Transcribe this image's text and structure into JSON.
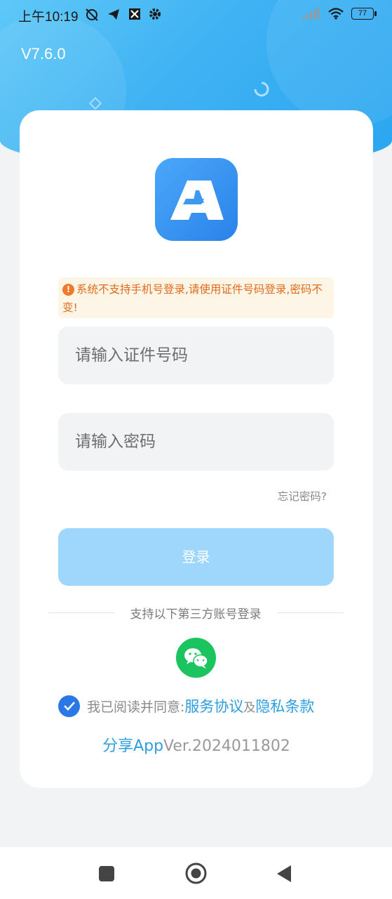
{
  "status_bar": {
    "time": "上午10:19",
    "battery": "77"
  },
  "header": {
    "version": "V7.6.0"
  },
  "notice": {
    "text": "系统不支持手机号登录,请使用证件号码登录,密码不变!"
  },
  "form": {
    "id_placeholder": "请输入证件号码",
    "password_placeholder": "请输入密码",
    "forgot_label": "忘记密码?",
    "login_label": "登录"
  },
  "third_party": {
    "label": "支持以下第三方账号登录"
  },
  "agreement": {
    "prefix": "我已阅读并同意:",
    "service": "服务协议",
    "and": "及",
    "privacy": "隐私条款",
    "checked": true
  },
  "footer": {
    "share": "分享App",
    "version": "Ver.2024011802"
  },
  "colors": {
    "accent": "#2aa6f0",
    "button": "#9ed7fb",
    "link": "#2d9ee0",
    "notice": "#e26a1a",
    "wechat": "#1cc45f"
  }
}
